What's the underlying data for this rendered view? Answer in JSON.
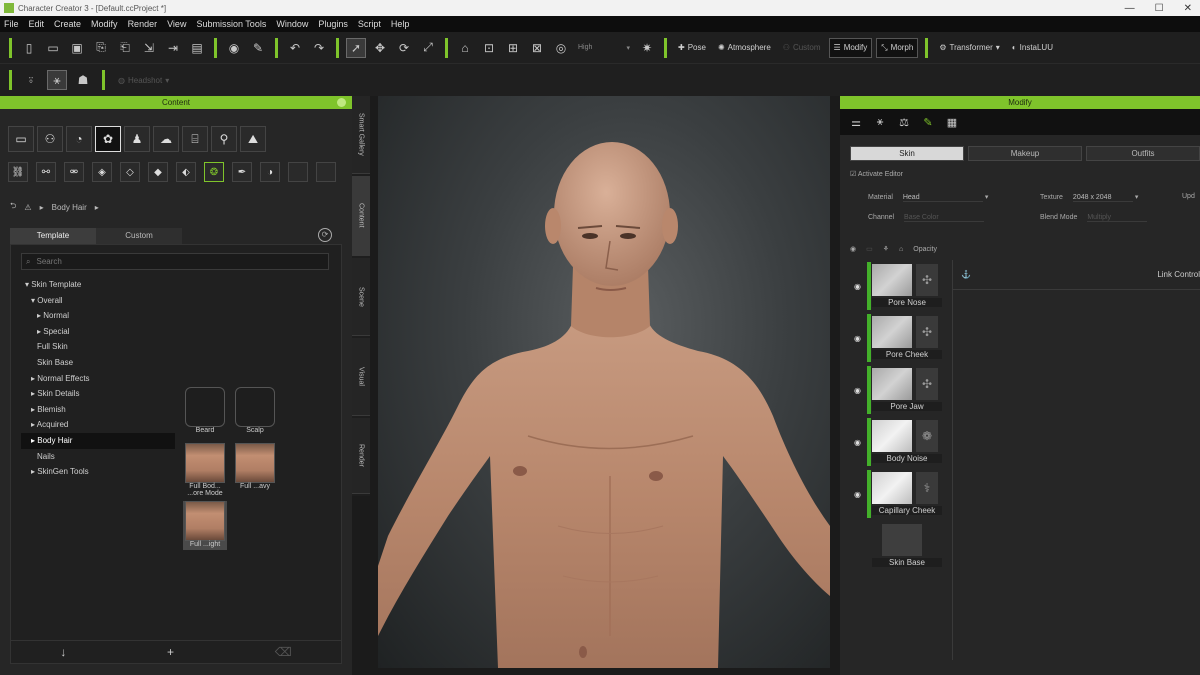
{
  "window": {
    "title": "Character Creator 3 - [Default.ccProject *]"
  },
  "menu": [
    "File",
    "Edit",
    "Create",
    "Modify",
    "Render",
    "View",
    "Submission Tools",
    "Window",
    "Plugins",
    "Script",
    "Help"
  ],
  "toolbar": {
    "quality": "High",
    "pose": "Pose",
    "atmosphere": "Atmosphere",
    "custom": "Custom",
    "modify": "Modify",
    "morph": "Morph",
    "transformer": "Transformer",
    "instaluu": "InstaLUU",
    "headshot": "Headshot"
  },
  "content": {
    "header": "Content",
    "breadcrumb": "Body Hair",
    "tabs": [
      "Template",
      "Custom"
    ],
    "search_placeholder": "Search",
    "tree": [
      "▾ Skin Template",
      "▾ Overall",
      "▸ Normal",
      "▸ Special",
      "Full Skin",
      "Skin Base",
      "▸ Normal Effects",
      "▸ Skin Details",
      "▸ Blemish",
      "▸ Acquired",
      "▸ Body Hair",
      "Nails",
      "▸ SkinGen Tools"
    ],
    "thumbs": [
      "Beard",
      "Scalp",
      "Full Bod... ...ore Mode",
      "Full ...avy",
      "Full ...ight"
    ]
  },
  "side_tabs": [
    "Smart Gallery",
    "Content",
    "Scene",
    "Visual",
    "Render"
  ],
  "modify": {
    "header": "Modify",
    "sub_tabs": [
      "Skin",
      "Makeup",
      "Outfits"
    ],
    "activate_editor": "Activate Editor",
    "material_label": "Material",
    "material_value": "Head",
    "texture_label": "Texture",
    "texture_value": "2048 x 2048",
    "update_label": "Upd",
    "channel_label": "Channel",
    "channel_value": "Base Color",
    "blend_label": "Blend Mode",
    "blend_value": "Multiply",
    "opacity_label": "Opacity",
    "link_control": "Link Control",
    "layers": [
      "Pore Nose",
      "Pore Cheek",
      "Pore Jaw",
      "Body Noise",
      "Capillary Cheek",
      "Skin Base"
    ]
  }
}
